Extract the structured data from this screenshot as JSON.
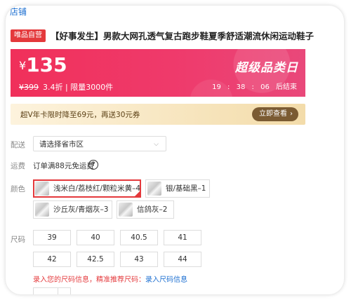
{
  "brand": {
    "mark": "店铺"
  },
  "product": {
    "badge": "唯品自营",
    "title": "【好事发生】男款大网孔透气复古跑步鞋夏季舒适潮流休闲运动鞋子"
  },
  "price": {
    "currency": "¥",
    "current": "135",
    "original": "¥399",
    "discount_limit": "3.4折 | 限量3000件",
    "event_name": "超级品类日",
    "countdown": {
      "h": "19",
      "m": "38",
      "s": "06",
      "suffix": "后结束"
    }
  },
  "vip": {
    "text": "超V年卡限时降至69元，再送30元券",
    "button": "立即查看"
  },
  "delivery": {
    "label": "配送",
    "select_value": "请选择省市区"
  },
  "shipping": {
    "label": "运费",
    "text": "订单满88元免运费",
    "help": "?"
  },
  "colors": {
    "label": "颜色",
    "options": [
      {
        "label": "浅米白/荔枝红/颗粒米黄–4",
        "selected": true
      },
      {
        "label": "银/基础黑–1",
        "selected": false
      },
      {
        "label": "沙丘灰/青烟灰–3",
        "selected": false
      },
      {
        "label": "信鸽灰–2",
        "selected": false
      }
    ]
  },
  "sizes": {
    "label": "尺码",
    "options": [
      "39",
      "40",
      "40.5",
      "41",
      "42",
      "42.5",
      "43",
      "44"
    ]
  },
  "size_tip": {
    "text": "录入您的尺码信息，精准推荐尺码：",
    "link": "录入尺码信息"
  },
  "accent": "#e4393c"
}
